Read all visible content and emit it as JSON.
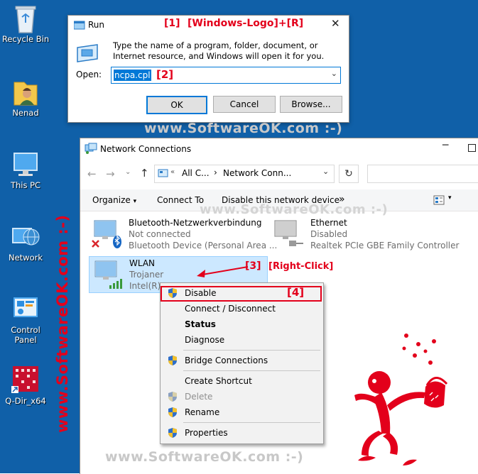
{
  "desktop": {
    "icons": [
      {
        "label": "Recycle Bin",
        "icon": "recycle-bin-icon"
      },
      {
        "label": "Nenad",
        "icon": "user-folder-icon"
      },
      {
        "label": "This PC",
        "icon": "computer-icon"
      },
      {
        "label": "Network",
        "icon": "network-globe-icon"
      },
      {
        "label": "Control Panel",
        "icon": "control-panel-icon"
      },
      {
        "label": "Q-Dir_x64",
        "icon": "q-dir-icon"
      }
    ]
  },
  "run_dialog": {
    "title": "Run",
    "description": "Type the name of a program, folder, document, or Internet resource, and Windows will open it for you.",
    "open_label": "Open:",
    "open_value": "ncpa.cpl",
    "ok": "OK",
    "cancel": "Cancel",
    "browse": "Browse..."
  },
  "annotations": {
    "a1": "[1]",
    "a1_text": "[Windows-Logo]+[R]",
    "a2": "[2]",
    "a3": "[3]",
    "a3_text": "[Right-Click]",
    "a4": "[4]"
  },
  "watermarks": {
    "h1": "www.SoftwareOK.com :-)",
    "h2": "www.SoftwareOK.com :-)",
    "h3": "www.SoftwareOK.com :-)",
    "vertical": "www.SoftwareOK.com :-)"
  },
  "network_window": {
    "title": "Network Connections",
    "address": {
      "part1": "All C...",
      "sep": "›",
      "part2": "Network Conn..."
    },
    "toolbar": {
      "organize": "Organize",
      "connect_to": "Connect To",
      "disable": "Disable this network device",
      "more": "»"
    },
    "connections": [
      {
        "name": "Bluetooth-Netzwerkverbindung",
        "status": "Not connected",
        "device": "Bluetooth Device (Personal Area ..."
      },
      {
        "name": "Ethernet",
        "status": "Disabled",
        "device": "Realtek PCIe GBE Family Controller"
      },
      {
        "name": "WLAN",
        "status": "Trojaner",
        "device": "Intel(R)"
      }
    ]
  },
  "context_menu": {
    "items": {
      "disable": "Disable",
      "connect": "Connect / Disconnect",
      "status": "Status",
      "diagnose": "Diagnose",
      "bridge": "Bridge Connections",
      "shortcut": "Create Shortcut",
      "delete": "Delete",
      "rename": "Rename",
      "properties": "Properties"
    }
  },
  "colors": {
    "accent": "#0078d7",
    "annotation": "#e3001b",
    "desktop": "#1060a8",
    "selection": "#cce8ff"
  }
}
